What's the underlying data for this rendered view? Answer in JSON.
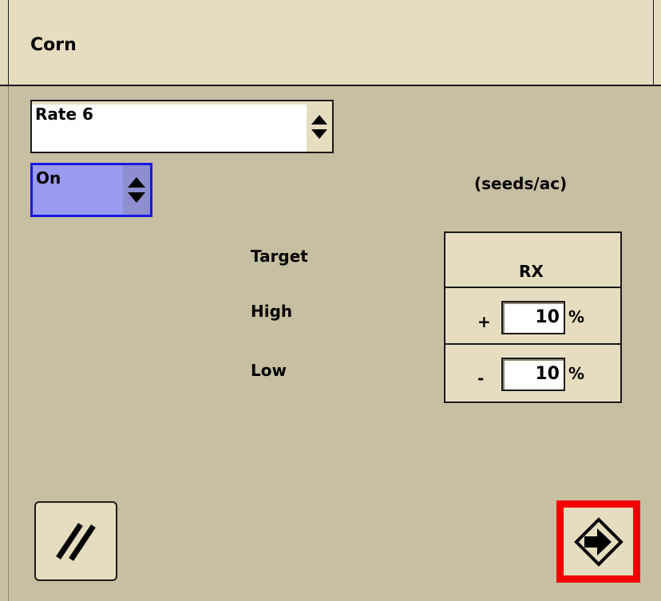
{
  "header": {
    "title": "Corn"
  },
  "rate_select": {
    "value": "Rate 6",
    "icon": "up-down-arrows-icon"
  },
  "state_select": {
    "value": "On",
    "icon": "up-down-arrows-icon"
  },
  "units": "(seeds/ac)",
  "rows": {
    "target": "Target",
    "high": "High",
    "low": "Low"
  },
  "rx": {
    "header": "RX",
    "high": {
      "sign": "+",
      "value": "10",
      "unit": "%"
    },
    "low": {
      "sign": "-",
      "value": "10",
      "unit": "%"
    }
  },
  "buttons": {
    "cancel_icon": "cancel-slashes-icon",
    "next_icon": "next-arrow-icon",
    "highlight_color": "#f20000"
  },
  "colors": {
    "panel": "#c7bfa1",
    "header": "#e6ddc0",
    "selected": "#9a9aef",
    "selected_border": "#1818e0"
  }
}
